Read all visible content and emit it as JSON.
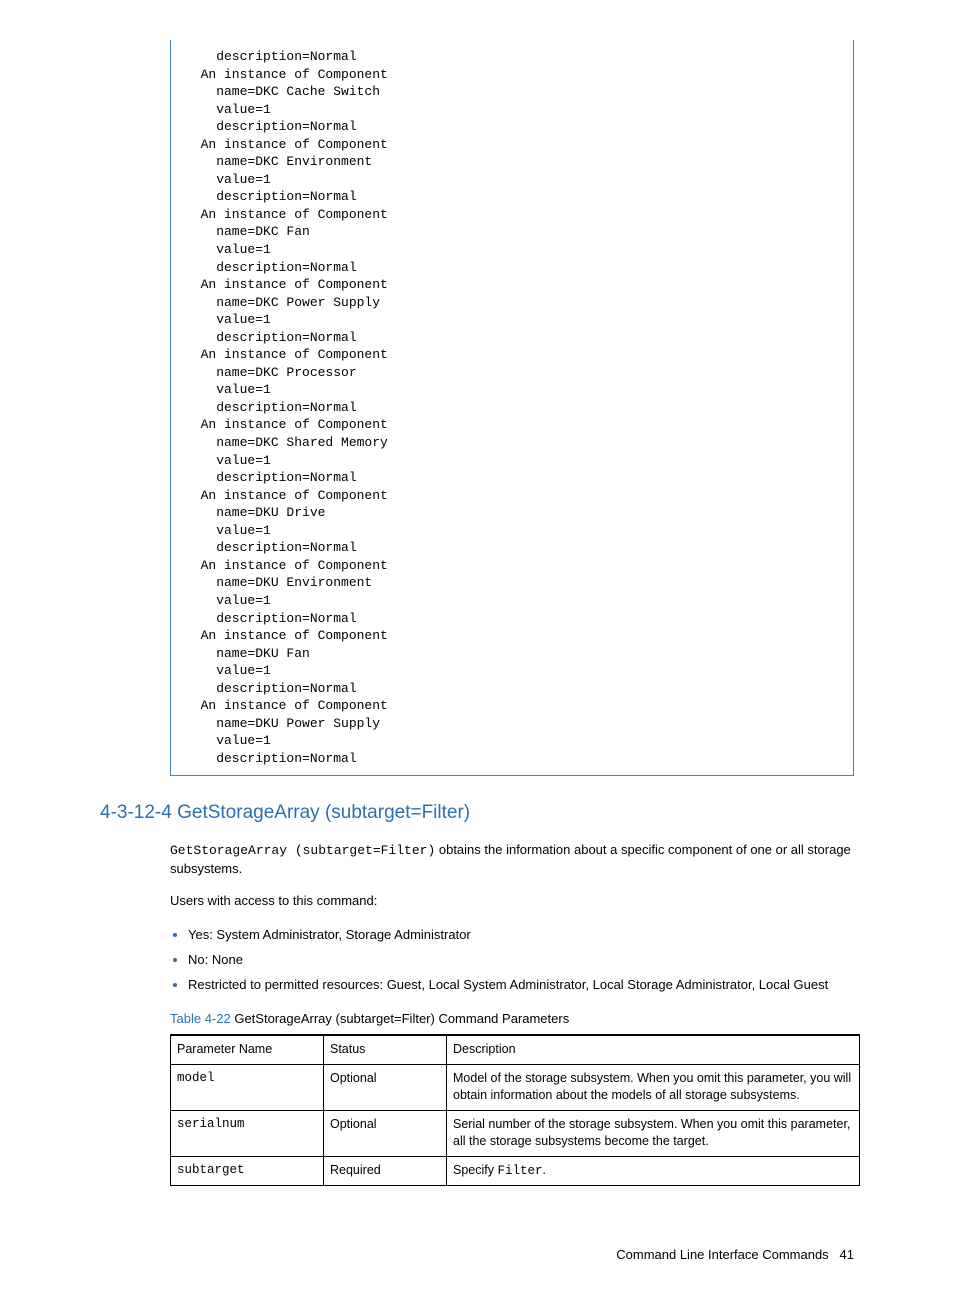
{
  "code_block": "    description=Normal\n  An instance of Component\n    name=DKC Cache Switch\n    value=1\n    description=Normal\n  An instance of Component\n    name=DKC Environment\n    value=1\n    description=Normal\n  An instance of Component\n    name=DKC Fan\n    value=1\n    description=Normal\n  An instance of Component\n    name=DKC Power Supply\n    value=1\n    description=Normal\n  An instance of Component\n    name=DKC Processor\n    value=1\n    description=Normal\n  An instance of Component\n    name=DKC Shared Memory\n    value=1\n    description=Normal\n  An instance of Component\n    name=DKU Drive\n    value=1\n    description=Normal\n  An instance of Component\n    name=DKU Environment\n    value=1\n    description=Normal\n  An instance of Component\n    name=DKU Fan\n    value=1\n    description=Normal\n  An instance of Component\n    name=DKU Power Supply\n    value=1\n    description=Normal",
  "heading": "4-3-12-4 GetStorageArray (subtarget=Filter)",
  "intro": {
    "mono": "GetStorageArray (subtarget=Filter)",
    "rest": " obtains the information about a specific component of one or all storage subsystems."
  },
  "access_label": "Users with access to this command:",
  "bullets": [
    "Yes: System Administrator, Storage Administrator",
    "No: None",
    "Restricted to permitted resources: Guest, Local System Administrator, Local Storage Administrator, Local Guest"
  ],
  "table_caption": {
    "prefix": "Table 4-22",
    "rest": "  GetStorageArray (subtarget=Filter) Command Parameters"
  },
  "table": {
    "headers": [
      "Parameter Name",
      "Status",
      "Description"
    ],
    "rows": [
      {
        "name": "model",
        "status": "Optional",
        "desc": "Model of the storage subsystem. When you omit this parameter, you will obtain information about the models of all storage subsystems."
      },
      {
        "name": "serialnum",
        "status": "Optional",
        "desc": "Serial number of the storage subsystem. When you omit this parameter, all the storage subsystems become the target."
      },
      {
        "name": "subtarget",
        "status": "Required",
        "desc_prefix": "Specify ",
        "desc_mono": "Filter",
        "desc_suffix": "."
      }
    ]
  },
  "footer": {
    "label": "Command Line Interface Commands",
    "page": "41"
  }
}
